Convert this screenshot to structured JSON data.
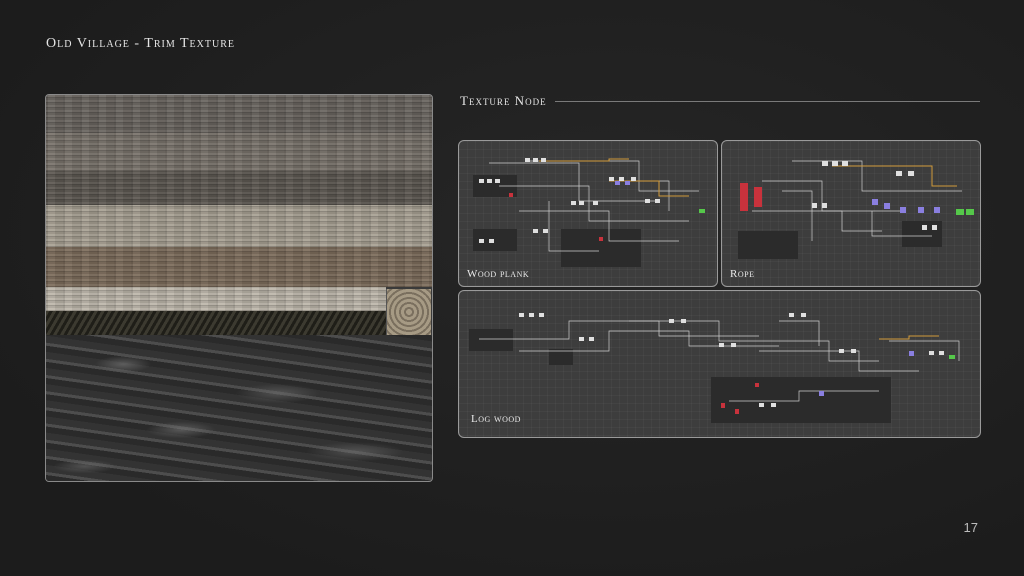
{
  "slide": {
    "title": "Old Village - Trim Texture",
    "page_number": "17"
  },
  "section": {
    "heading": "Texture Node"
  },
  "panels": [
    {
      "label": "Wood plank"
    },
    {
      "label": "Rope"
    },
    {
      "label": "Log wood"
    }
  ],
  "colors": {
    "background": "#1f1f1f",
    "panel_bg": "#3d3d3d",
    "node_wire_orange": "#d19a3a",
    "node_purple": "#8a7fe0",
    "node_red": "#c8323c",
    "node_green": "#55c84a"
  }
}
